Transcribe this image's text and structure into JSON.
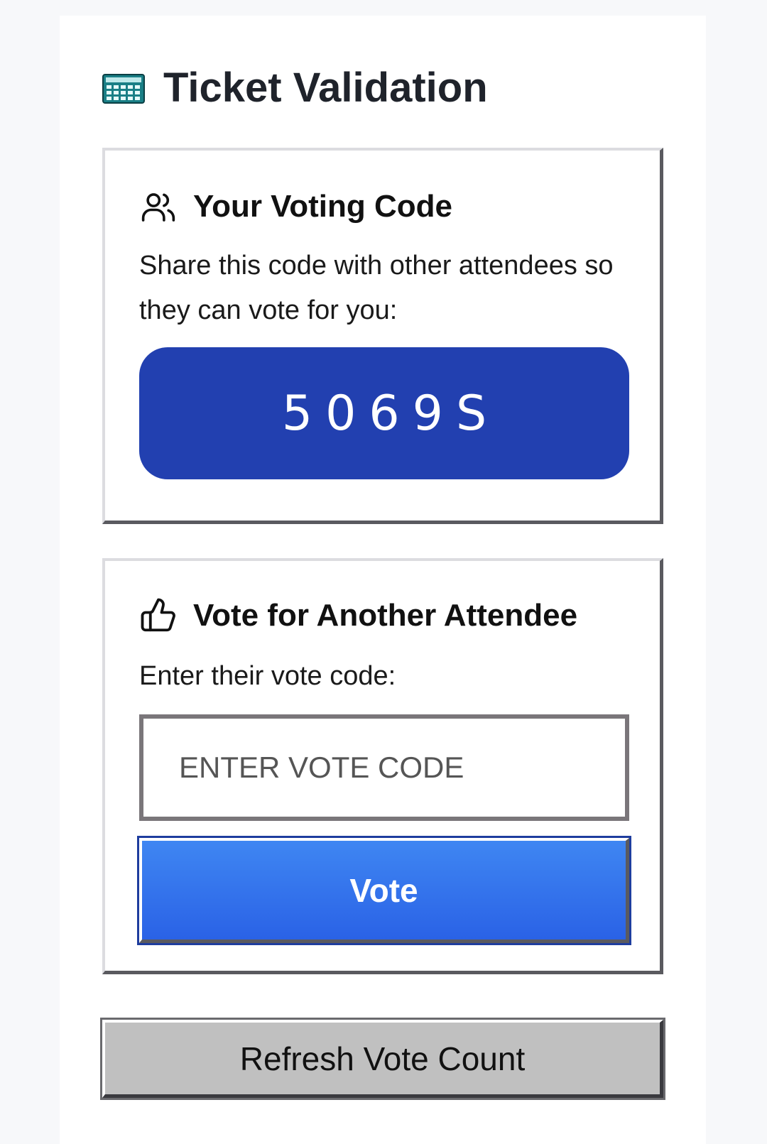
{
  "header": {
    "icon": "calculator-icon",
    "title": "Ticket Validation"
  },
  "voting_code_panel": {
    "icon": "users-icon",
    "title": "Your Voting Code",
    "description": "Share this code with other attendees so they can vote for you:",
    "code": "5069S"
  },
  "vote_panel": {
    "icon": "thumbs-up-icon",
    "title": "Vote for Another Attendee",
    "description": "Enter their vote code:",
    "input_placeholder": "ENTER VOTE CODE",
    "input_value": "",
    "vote_button_label": "Vote"
  },
  "refresh_button_label": "Refresh Vote Count",
  "colors": {
    "code_background": "#2240b0",
    "vote_button": "#2f6fec",
    "refresh_button": "#c0c0c0"
  }
}
